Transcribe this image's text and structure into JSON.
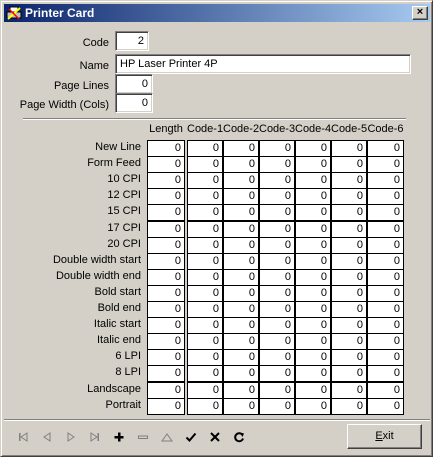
{
  "window": {
    "title": "Printer Card",
    "close_label": "×"
  },
  "fields": {
    "code_label": "Code",
    "code_value": "2",
    "name_label": "Name",
    "name_value": "HP Laser Printer 4P",
    "page_lines_label": "Page Lines",
    "page_lines_value": "0",
    "page_width_label": "Page Width (Cols)",
    "page_width_value": "0"
  },
  "grid": {
    "columns": [
      "Length",
      "Code-1",
      "Code-2",
      "Code-3",
      "Code-4",
      "Code-5",
      "Code-6"
    ],
    "rows": [
      {
        "label": "New Line",
        "values": [
          "0",
          "0",
          "0",
          "0",
          "0",
          "0",
          "0"
        ]
      },
      {
        "label": "Form Feed",
        "values": [
          "0",
          "0",
          "0",
          "0",
          "0",
          "0",
          "0"
        ]
      },
      {
        "label": "10 CPI",
        "values": [
          "0",
          "0",
          "0",
          "0",
          "0",
          "0",
          "0"
        ]
      },
      {
        "label": "12 CPI",
        "values": [
          "0",
          "0",
          "0",
          "0",
          "0",
          "0",
          "0"
        ]
      },
      {
        "label": "15 CPI",
        "values": [
          "0",
          "0",
          "0",
          "0",
          "0",
          "0",
          "0"
        ]
      },
      {
        "label": "17 CPI",
        "values": [
          "0",
          "0",
          "0",
          "0",
          "0",
          "0",
          "0"
        ]
      },
      {
        "label": "20 CPI",
        "values": [
          "0",
          "0",
          "0",
          "0",
          "0",
          "0",
          "0"
        ]
      },
      {
        "label": "Double width start",
        "values": [
          "0",
          "0",
          "0",
          "0",
          "0",
          "0",
          "0"
        ]
      },
      {
        "label": "Double width end",
        "values": [
          "0",
          "0",
          "0",
          "0",
          "0",
          "0",
          "0"
        ]
      },
      {
        "label": "Bold start",
        "values": [
          "0",
          "0",
          "0",
          "0",
          "0",
          "0",
          "0"
        ]
      },
      {
        "label": "Bold end",
        "values": [
          "0",
          "0",
          "0",
          "0",
          "0",
          "0",
          "0"
        ]
      },
      {
        "label": "Italic start",
        "values": [
          "0",
          "0",
          "0",
          "0",
          "0",
          "0",
          "0"
        ]
      },
      {
        "label": "Italic end",
        "values": [
          "0",
          "0",
          "0",
          "0",
          "0",
          "0",
          "0"
        ]
      },
      {
        "label": "6 LPI",
        "values": [
          "0",
          "0",
          "0",
          "0",
          "0",
          "0",
          "0"
        ]
      },
      {
        "label": "8 LPI",
        "values": [
          "0",
          "0",
          "0",
          "0",
          "0",
          "0",
          "0"
        ]
      },
      {
        "label": "Landscape",
        "values": [
          "0",
          "0",
          "0",
          "0",
          "0",
          "0",
          "0"
        ]
      },
      {
        "label": "Portrait",
        "values": [
          "0",
          "0",
          "0",
          "0",
          "0",
          "0",
          "0"
        ]
      }
    ]
  },
  "toolbar": {
    "buttons": [
      {
        "name": "first-record-button",
        "icon": "first-icon",
        "enabled": false
      },
      {
        "name": "prior-record-button",
        "icon": "prior-icon",
        "enabled": false
      },
      {
        "name": "next-record-button",
        "icon": "next-icon",
        "enabled": false
      },
      {
        "name": "last-record-button",
        "icon": "last-icon",
        "enabled": false
      },
      {
        "name": "insert-button",
        "icon": "plus-icon",
        "enabled": true
      },
      {
        "name": "delete-button",
        "icon": "minus-icon",
        "enabled": false
      },
      {
        "name": "edit-button",
        "icon": "edit-triangle-icon",
        "enabled": false
      },
      {
        "name": "post-button",
        "icon": "check-icon",
        "enabled": true
      },
      {
        "name": "cancel-button",
        "icon": "x-icon",
        "enabled": true
      },
      {
        "name": "refresh-button",
        "icon": "refresh-icon",
        "enabled": true
      }
    ],
    "exit_label_accel": "E",
    "exit_label_rest": "xit"
  },
  "colors": {
    "title_start": "#0a246a",
    "title_end": "#a6caf0",
    "face": "#d4d0c8",
    "disabled": "#808080"
  }
}
